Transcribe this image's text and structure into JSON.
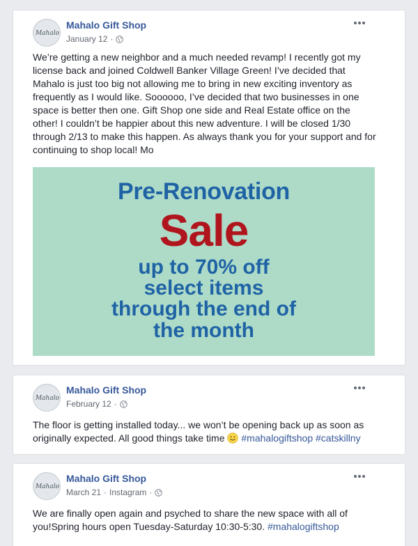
{
  "posts": [
    {
      "author": "Mahalo Gift Shop",
      "date": "January 12",
      "text": "We’re getting a new neighbor and a much needed revamp! I recently got my license back and joined Coldwell Banker Village Green! I’ve decided that Mahalo is just too big not allowing me to bring in new exciting inventory as frequently as I would like. Soooooo, I’ve decided that two businesses in one space is better then one. Gift Shop one side and Real Estate office on the other! I couldn’t be happier about this new adventure. I will be closed 1/30 through 2/13 to make this happen. As always thank you for your support and for continuing to shop local! Mo",
      "image": {
        "line1": "Pre-Renovation",
        "line2": "Sale",
        "line3": "up to 70% off",
        "line4": "select items",
        "line5": "through the end of",
        "line6": "the month"
      }
    },
    {
      "author": "Mahalo Gift Shop",
      "date": "February 12",
      "text": "The floor is getting installed today... we won’t be opening back up as soon as originally expected. All good things take time",
      "hashtags": "#mahalogiftshop #catskillny"
    },
    {
      "author": "Mahalo Gift Shop",
      "date": "March 21",
      "source": "Instagram",
      "text": "We are finally open again and psyched to share the new space with all of you!Spring hours open Tuesday-Saturday 10:30-5:30.",
      "hashtags": "#mahalogiftshop"
    }
  ],
  "separator": "·",
  "avatar_text": "Mahalo",
  "colors": {
    "link": "#365899",
    "promo_bg": "#aedbc8",
    "promo_blue": "#1f63a5",
    "promo_red": "#b0151d"
  }
}
